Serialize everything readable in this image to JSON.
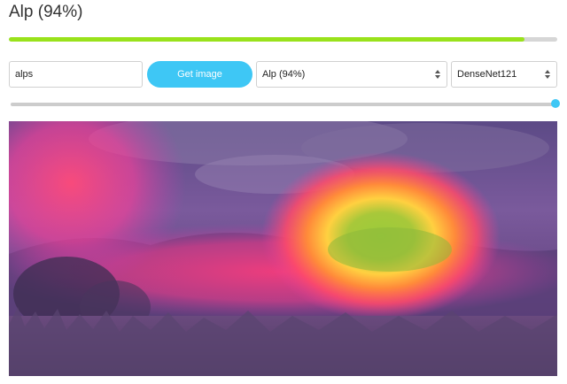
{
  "header": {
    "title": "Alp (94%)"
  },
  "progress": {
    "value": 0.94,
    "fill_color": "#99e21b",
    "track_color": "#d6d6d6"
  },
  "controls": {
    "query_value": "alps",
    "get_image_label": "Get image",
    "class_select_value": "Alp (94%)",
    "model_select_value": "DenseNet121",
    "button_color": "#3ec7f5"
  },
  "slider": {
    "value": 1.0
  },
  "image": {
    "icon": "saliency-heatmap-image"
  }
}
